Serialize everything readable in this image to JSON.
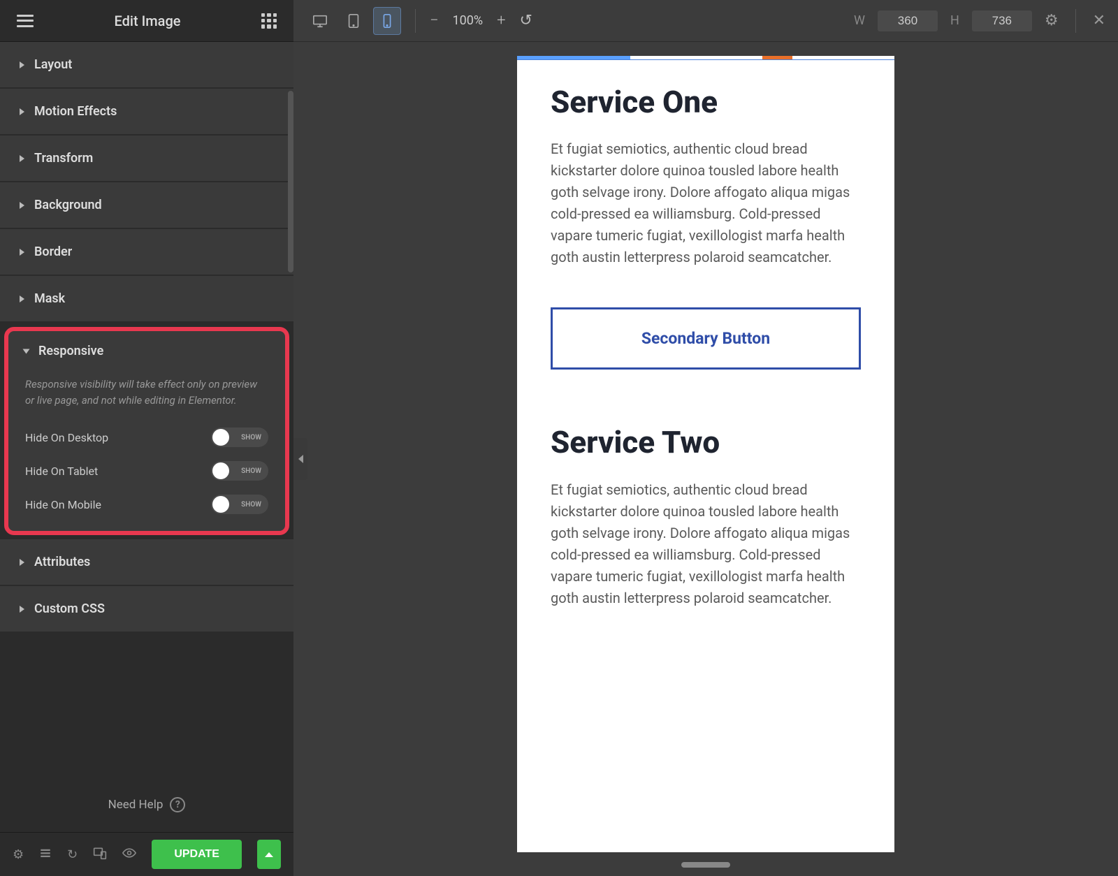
{
  "sidebar": {
    "title": "Edit Image",
    "sections": {
      "layout": "Layout",
      "motion_effects": "Motion Effects",
      "transform": "Transform",
      "background": "Background",
      "border": "Border",
      "mask": "Mask",
      "responsive": "Responsive",
      "attributes": "Attributes",
      "custom_css": "Custom CSS"
    },
    "responsive": {
      "note": "Responsive visibility will take effect only on preview or live page, and not while editing in Elementor.",
      "hide_desktop": "Hide On Desktop",
      "hide_tablet": "Hide On Tablet",
      "hide_mobile": "Hide On Mobile",
      "toggle_state": "SHOW"
    },
    "need_help": "Need Help",
    "update_label": "UPDATE"
  },
  "topbar": {
    "zoom": "100%",
    "w_label": "W",
    "h_label": "H",
    "width": "360",
    "height": "736"
  },
  "preview": {
    "service1": {
      "title": "Service One",
      "desc": "Et fugiat semiotics, authentic cloud bread kickstarter dolore quinoa tousled labore health goth selvage irony. Dolore affogato aliqua migas cold-pressed ea williamsburg. Cold-pressed vapare tumeric fugiat, vexillologist marfa health goth austin letterpress polaroid seamcatcher.",
      "button": "Secondary Button"
    },
    "service2": {
      "title": "Service Two",
      "desc": "Et fugiat semiotics, authentic cloud bread kickstarter dolore quinoa tousled labore health goth selvage irony. Dolore affogato aliqua migas cold-pressed ea williamsburg. Cold-pressed vapare tumeric fugiat, vexillologist marfa health goth austin letterpress polaroid seamcatcher."
    }
  }
}
